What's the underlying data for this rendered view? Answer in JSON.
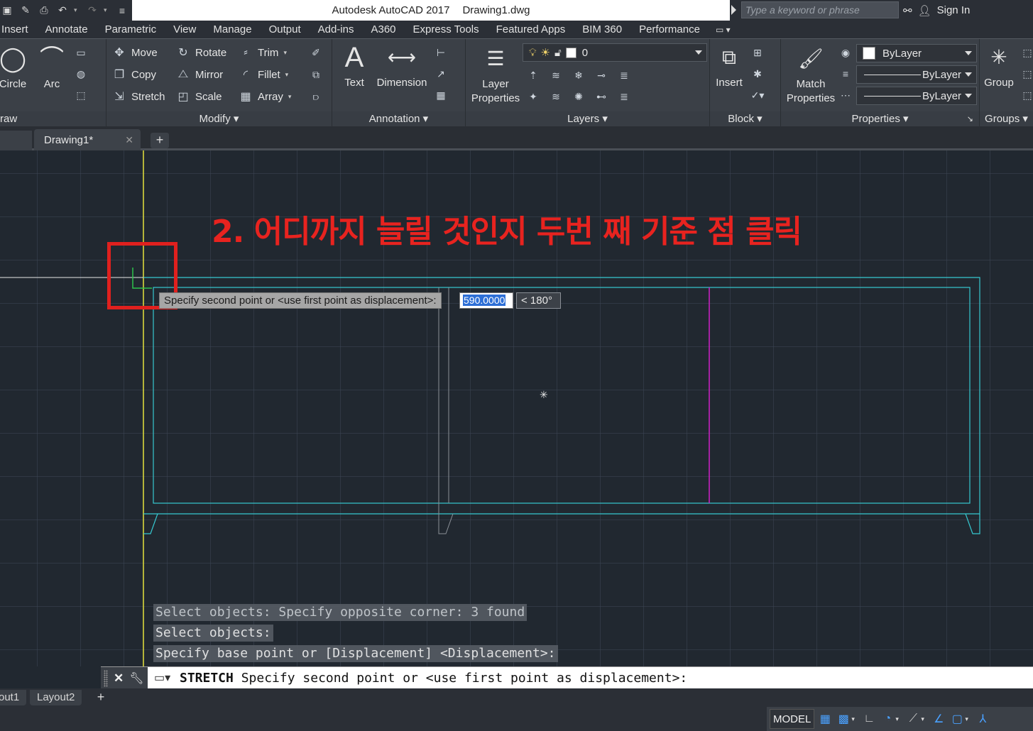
{
  "titlebar": {
    "app_title": "Autodesk AutoCAD 2017",
    "file_name": "Drawing1.dwg",
    "search_placeholder": "Type a keyword or phrase",
    "sign_in": "Sign In"
  },
  "ribbon_tabs": [
    "Insert",
    "Annotate",
    "Parametric",
    "View",
    "Manage",
    "Output",
    "Add-ins",
    "A360",
    "Express Tools",
    "Featured Apps",
    "BIM 360",
    "Performance"
  ],
  "draw_panel": {
    "title": "raw",
    "circle": "Circle",
    "arc": "Arc"
  },
  "modify_panel": {
    "title": "Modify",
    "move": "Move",
    "rotate": "Rotate",
    "trim": "Trim",
    "copy": "Copy",
    "mirror": "Mirror",
    "fillet": "Fillet",
    "stretch": "Stretch",
    "scale": "Scale",
    "array": "Array"
  },
  "annotation_panel": {
    "title": "Annotation",
    "text": "Text",
    "dimension": "Dimension"
  },
  "layers_panel": {
    "title": "Layers",
    "layer_properties_1": "Layer",
    "layer_properties_2": "Properties",
    "current_layer": "0"
  },
  "block_panel": {
    "title": "Block",
    "insert": "Insert"
  },
  "properties_panel": {
    "title": "Properties",
    "match_1": "Match",
    "match_2": "Properties",
    "color": "ByLayer",
    "linetype": "ByLayer",
    "lineweight": "ByLayer"
  },
  "groups_panel": {
    "title": "Groups",
    "group": "Group"
  },
  "file_tabs": {
    "active": "Drawing1*"
  },
  "canvas": {
    "annotation": "2. 어디까지 늘릴 것인지 두번 째 기준 점 클릭",
    "dynamic_prompt": "Specify second point or <use first point as displacement>:",
    "dynamic_value": "590.0000",
    "dynamic_angle": "< 180°"
  },
  "command_history": [
    "Select objects: Specify opposite corner: 3 found",
    "Select objects:",
    "Specify base point or [Displacement] <Displacement>:"
  ],
  "command_line": {
    "command": "STRETCH",
    "prompt": "Specify second point or <use first point as displacement>:"
  },
  "layout_tabs": [
    "out1",
    "Layout2"
  ],
  "status": {
    "model": "MODEL"
  },
  "colors": {
    "cyan_geometry": "#36c8d0",
    "magenta_line": "#d020c8",
    "crosshair": "#e6e23c",
    "annotation_red": "#e8231f"
  }
}
